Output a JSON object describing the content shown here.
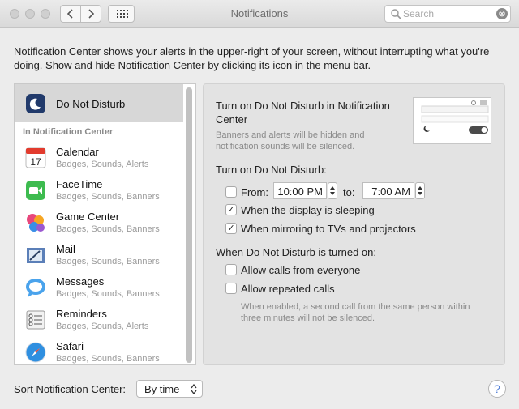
{
  "window": {
    "title": "Notifications"
  },
  "search": {
    "placeholder": "Search",
    "clear_symbol": "⊗"
  },
  "description": "Notification Center shows your alerts in the upper-right of your screen, without interrupting what you're doing. Show and hide Notification Center by clicking its icon in the menu bar.",
  "sidebar": {
    "selected": {
      "label": "Do Not Disturb",
      "icon": "moon-icon"
    },
    "section_header": "In Notification Center",
    "items": [
      {
        "name": "Calendar",
        "sub": "Badges, Sounds, Alerts",
        "icon": "calendar-icon",
        "color": "#e23b2e",
        "day": "17"
      },
      {
        "name": "FaceTime",
        "sub": "Badges, Sounds, Banners",
        "icon": "facetime-icon",
        "color": "#3dbb4f"
      },
      {
        "name": "Game Center",
        "sub": "Badges, Sounds, Banners",
        "icon": "game-center-icon",
        "color": "#e8477c"
      },
      {
        "name": "Mail",
        "sub": "Badges, Sounds, Banners",
        "icon": "mail-icon",
        "color": "#5b7fb8"
      },
      {
        "name": "Messages",
        "sub": "Badges, Sounds, Banners",
        "icon": "messages-icon",
        "color": "#4aa3ec"
      },
      {
        "name": "Reminders",
        "sub": "Badges, Sounds, Alerts",
        "icon": "reminders-icon",
        "color": "#f2f2f2"
      },
      {
        "name": "Safari",
        "sub": "Badges, Sounds, Banners",
        "icon": "safari-icon",
        "color": "#2f8fe0"
      }
    ]
  },
  "panel": {
    "dnd_nc_title": "Turn on Do Not Disturb in Notification Center",
    "dnd_nc_desc": "Banners and alerts will be hidden and notification sounds will be silenced.",
    "turn_on_header": "Turn on Do Not Disturb:",
    "from_label": "From:",
    "from_time": "10:00 PM",
    "to_label": "to:",
    "to_time": "7:00 AM",
    "from_checked": false,
    "display_sleeping_label": "When the display is sleeping",
    "display_sleeping_checked": true,
    "mirroring_label": "When mirroring to TVs and projectors",
    "mirroring_checked": true,
    "when_on_header": "When Do Not Disturb is turned on:",
    "allow_calls_label": "Allow calls from everyone",
    "allow_calls_checked": false,
    "repeated_calls_label": "Allow repeated calls",
    "repeated_calls_checked": false,
    "repeated_calls_note": "When enabled, a second call from the same person within three minutes will not be silenced.",
    "check_mark": "✓"
  },
  "footer": {
    "sort_label": "Sort Notification Center:",
    "sort_value": "By time",
    "help_symbol": "?"
  }
}
